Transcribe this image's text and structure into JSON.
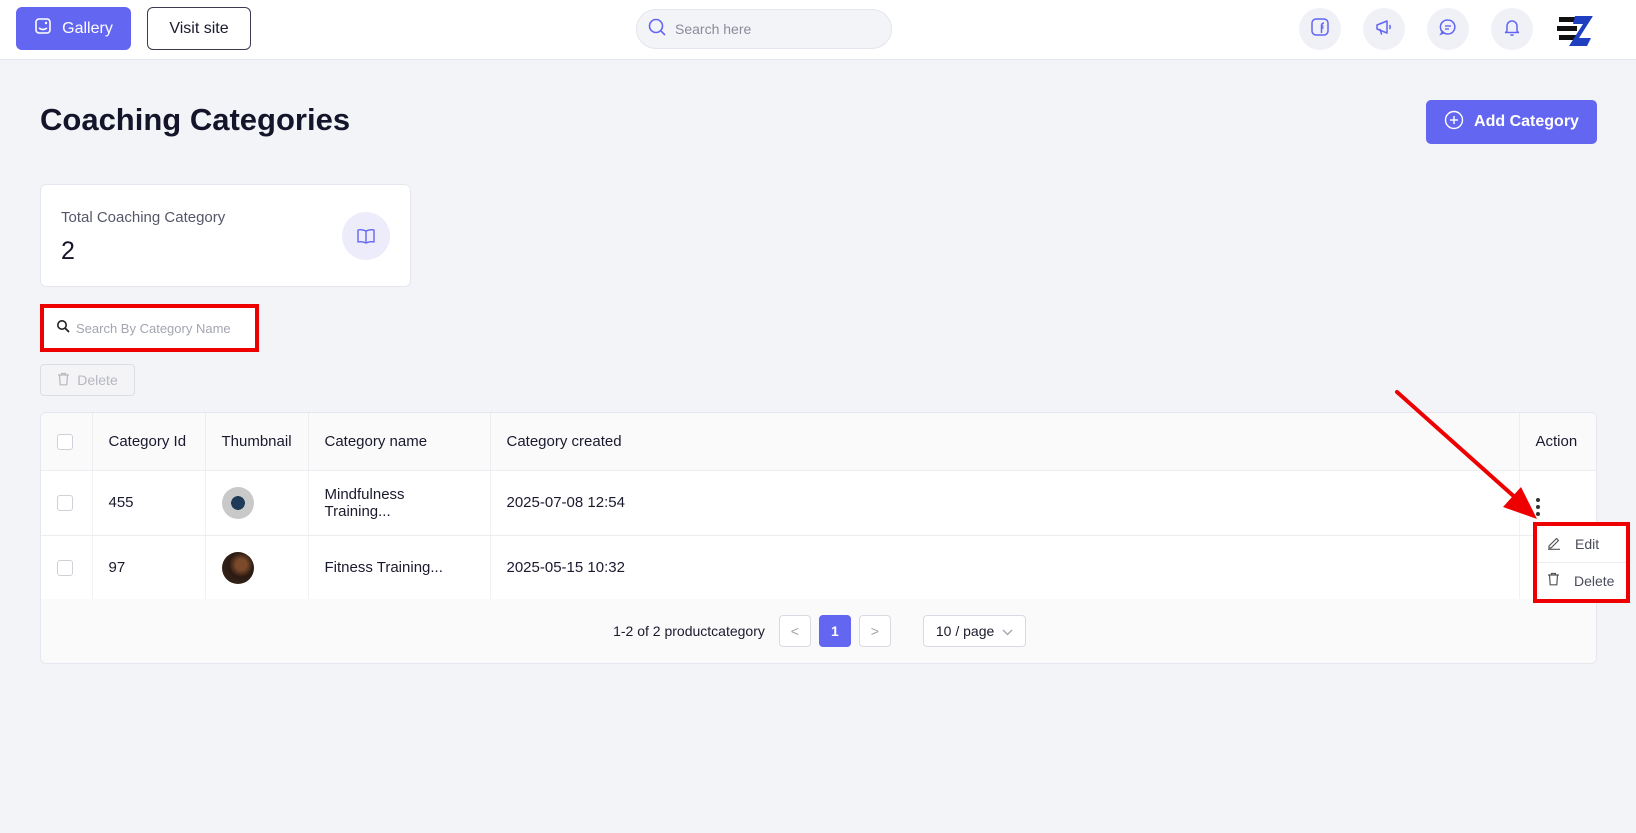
{
  "topbar": {
    "gallery_label": "Gallery",
    "visit_label": "Visit site",
    "search_placeholder": "Search here"
  },
  "page": {
    "title": "Coaching Categories",
    "add_label": "Add Category"
  },
  "stat": {
    "label": "Total Coaching Category",
    "value": "2"
  },
  "category_search": {
    "placeholder": "Search By Category Name"
  },
  "bulk": {
    "delete_label": "Delete"
  },
  "table": {
    "columns": [
      "Category Id",
      "Thumbnail",
      "Category name",
      "Category created",
      "Action"
    ],
    "rows": [
      {
        "id": "455",
        "name": "Mindfulness Training...",
        "created": "2025-07-08 12:54"
      },
      {
        "id": "97",
        "name": "Fitness Training...",
        "created": "2025-05-15 10:32"
      }
    ]
  },
  "pagination": {
    "summary": "1-2 of 2 productcategory",
    "current_page": "1",
    "prev": "<",
    "next": ">",
    "page_size": "10 / page"
  },
  "dropdown": {
    "edit_label": "Edit",
    "delete_label": "Delete"
  },
  "colors": {
    "accent": "#6366f1",
    "annotation": "#ef0000"
  }
}
